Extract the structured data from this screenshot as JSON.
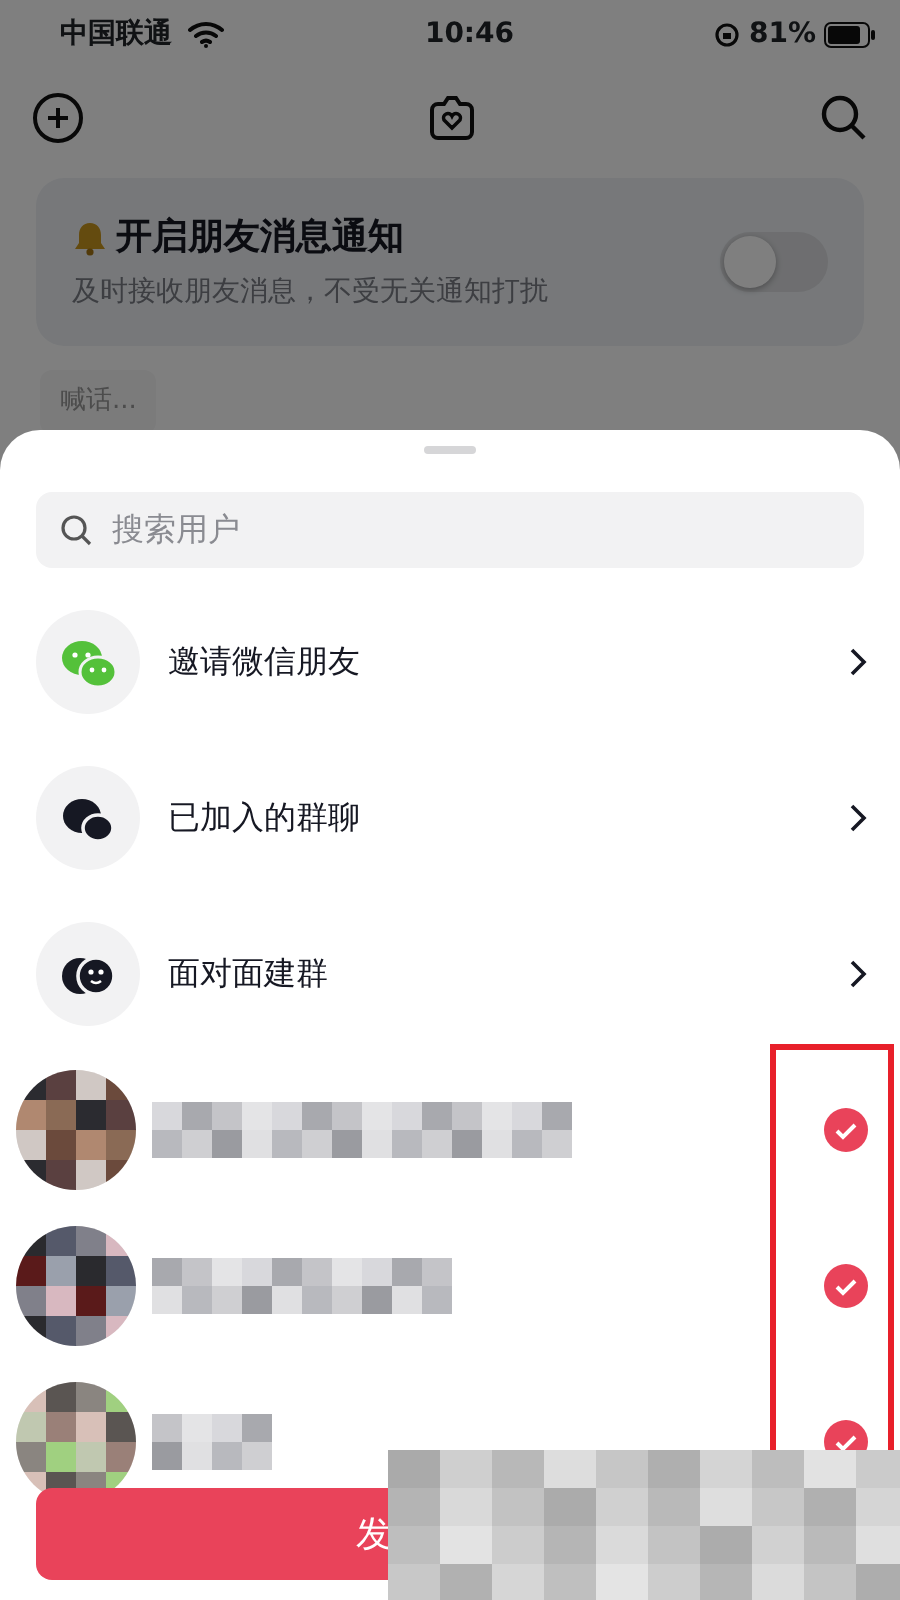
{
  "status_bar": {
    "carrier": "中国联通",
    "time": "10:46",
    "battery": "81%"
  },
  "notice": {
    "title": "开启朋友消息通知",
    "subtitle": "及时接收朋友消息，不受无关通知打扰",
    "on": false
  },
  "shout_chip": "喊话...",
  "sheet": {
    "search": {
      "placeholder": "搜索用户"
    },
    "options": [
      {
        "kind": "wechat",
        "label": "邀请微信朋友"
      },
      {
        "kind": "groups",
        "label": "已加入的群聊"
      },
      {
        "kind": "face",
        "label": "面对面建群"
      }
    ],
    "contacts": [
      {
        "selected": true
      },
      {
        "selected": true
      },
      {
        "selected": true
      }
    ],
    "send_button": "发"
  }
}
